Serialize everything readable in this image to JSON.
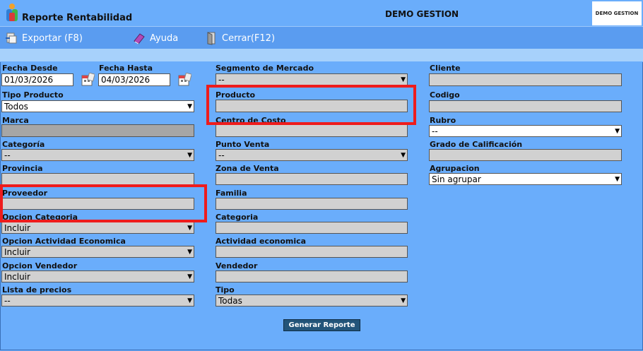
{
  "header": {
    "title": "Reporte Rentabilidad",
    "company": "DEMO GESTION",
    "brand": "DEMO GESTION"
  },
  "toolbar": {
    "export": "Exportar (F8)",
    "help": "Ayuda",
    "close": "Cerrar(F12)"
  },
  "form": {
    "fecha_desde": {
      "label": "Fecha Desde",
      "value": "01/03/2026"
    },
    "fecha_hasta": {
      "label": "Fecha Hasta",
      "value": "04/03/2026"
    },
    "segmento": {
      "label": "Segmento de Mercado",
      "value": "--"
    },
    "cliente": {
      "label": "Cliente",
      "value": ""
    },
    "tipo_producto": {
      "label": "Tipo Producto",
      "value": "Todos"
    },
    "producto": {
      "label": "Producto",
      "value": ""
    },
    "codigo": {
      "label": "Codigo",
      "value": ""
    },
    "marca": {
      "label": "Marca",
      "value": ""
    },
    "centro_costo": {
      "label": "Centro de Costo",
      "value": ""
    },
    "rubro": {
      "label": "Rubro",
      "value": "--"
    },
    "categoria": {
      "label": "Categoría",
      "value": "--"
    },
    "punto_venta": {
      "label": "Punto Venta",
      "value": "--"
    },
    "grado_calificacion": {
      "label": "Grado de Calificación",
      "value": ""
    },
    "provincia": {
      "label": "Provincia",
      "value": ""
    },
    "zona_venta": {
      "label": "Zona de Venta",
      "value": ""
    },
    "agrupacion": {
      "label": "Agrupacion",
      "value": "Sin agrupar"
    },
    "proveedor": {
      "label": "Proveedor",
      "value": ""
    },
    "familia": {
      "label": "Familia",
      "value": ""
    },
    "opcion_categoria": {
      "label": "Opcion Categoria",
      "value": "Incluir"
    },
    "categoria2": {
      "label": "Categoria",
      "value": ""
    },
    "opcion_actividad": {
      "label": "Opcion Actividad Economica",
      "value": "Incluir"
    },
    "actividad": {
      "label": "Actividad economica",
      "value": ""
    },
    "opcion_vendedor": {
      "label": "Opcion Vendedor",
      "value": "Incluir"
    },
    "vendedor": {
      "label": "Vendedor",
      "value": ""
    },
    "lista_precios": {
      "label": "Lista de precios",
      "value": "--"
    },
    "tipo": {
      "label": "Tipo",
      "value": "Todas"
    }
  },
  "actions": {
    "generate": "Generar Reporte"
  },
  "colors": {
    "background": "#6aadfb",
    "toolbar": "#5a9cf0",
    "strip": "#a7d1fb",
    "button": "#23557a",
    "highlight": "#ee1c1c"
  }
}
